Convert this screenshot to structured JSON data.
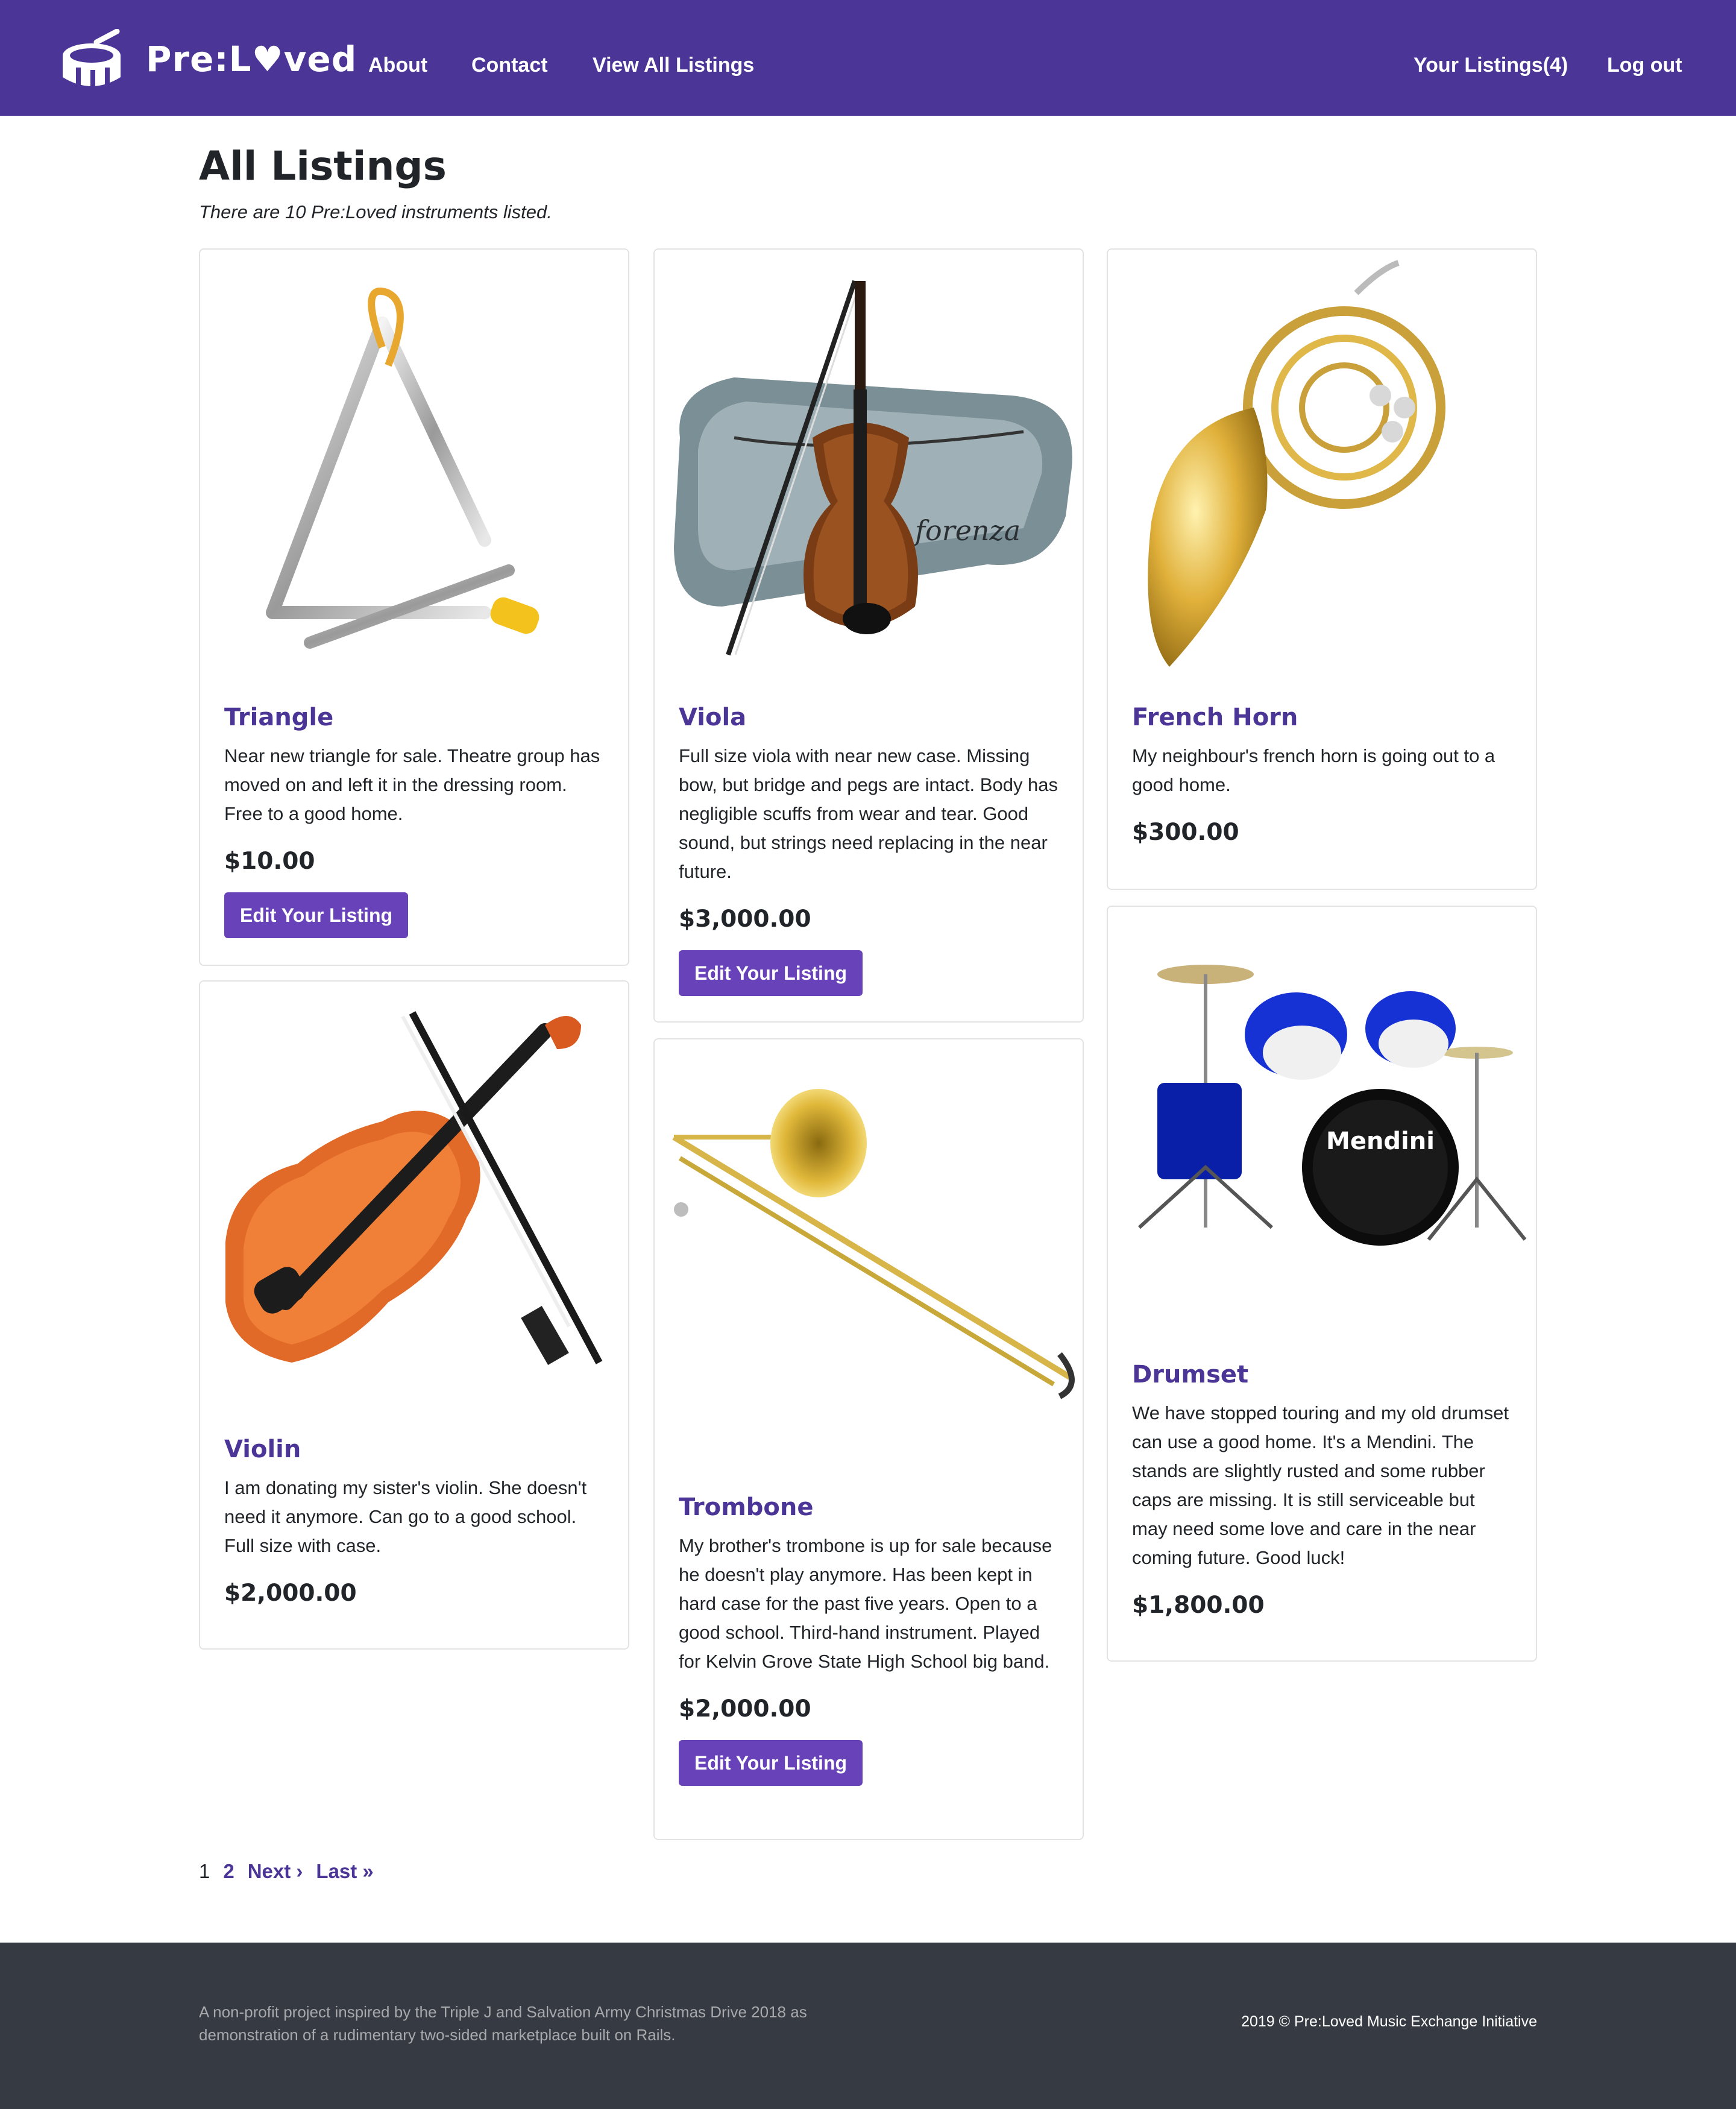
{
  "nav": {
    "brand": "Pre:L♥ved",
    "links": [
      "About",
      "Contact",
      "View All Listings"
    ],
    "your_listings": "Your Listings(4)",
    "logout": "Log out"
  },
  "page": {
    "title": "All Listings",
    "subtitle": "There are 10 Pre:Loved instruments listed."
  },
  "listings": [
    {
      "title": "Triangle",
      "description": "Near new triangle for sale. Theatre group has moved on and left it in the dressing room. Free to a good home.",
      "price": "$10.00",
      "button": "Edit Your Listing",
      "image": "triangle-photo"
    },
    {
      "title": "Viola",
      "description": "Full size viola with near new case. Missing bow, but bridge and pegs are intact. Body has negligible scuffs from wear and tear. Good sound, but strings need replacing in the near future.",
      "price": "$3,000.00",
      "button": "Edit Your Listing",
      "image": "viola-photo",
      "case_logo": "forenza"
    },
    {
      "title": "French Horn",
      "description": "My neighbour's french horn is going out to a good home.",
      "price": "$300.00",
      "image": "french-horn-photo"
    },
    {
      "title": "Violin",
      "description": "I am donating my sister's violin. She doesn't need it anymore. Can go to a good school. Full size with case.",
      "price": "$2,000.00",
      "image": "violin-photo"
    },
    {
      "title": "Trombone",
      "description": "My brother's trombone is up for sale because he doesn't play anymore. Has been kept in hard case for the past five years. Open to a good school. Third-hand instrument. Played for Kelvin Grove State High School big band.",
      "price": "$2,000.00",
      "button": "Edit Your Listing",
      "image": "trombone-photo"
    },
    {
      "title": "Drumset",
      "description": "We have stopped touring and my old drumset can use a good home. It's a Mendini. The stands are slightly rusted and some rubber caps are missing. It is still serviceable but may need some love and care in the near coming future. Good luck!",
      "price": "$1,800.00",
      "image": "drumset-photo",
      "drum_logo": "Mendini"
    }
  ],
  "pagination": {
    "current": "1",
    "page2": "2",
    "next": "Next ›",
    "last": "Last »"
  },
  "footer": {
    "left": "A non-profit project inspired by the Triple J and Salvation Army Christmas Drive 2018 as demonstration of a rudimentary two-sided marketplace built on Rails.",
    "right": "2019 © Pre:Loved Music Exchange Initiative"
  },
  "colors": {
    "navbar": "#4b3596",
    "accent": "#4b3596",
    "button": "#6742b8",
    "footer": "#363a42"
  }
}
